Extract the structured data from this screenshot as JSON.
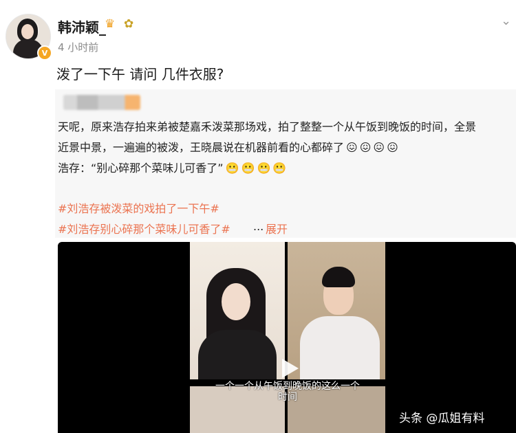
{
  "author": {
    "name": "韩沛颖_",
    "crown_icon": "crown-icon",
    "flower_icon": "flower-icon",
    "verified_badge": "V",
    "time": "4 小时前"
  },
  "post": {
    "text": "泼了一下午  请问  几件衣服?"
  },
  "quote": {
    "lines": [
      "天呢，原来浩存拍来弟被楚嘉禾泼菜那场戏，拍了整整一个从午饭到晚饭的时间，全景",
      "近景中景，一遍遍的被泼，王晓晨说在机器前看的心都碎了",
      "浩存：“别心碎那个菜味儿可香了”"
    ],
    "line2_emojis": [
      "😖",
      "😖",
      "😖",
      "😖"
    ],
    "line3_emojis": [
      "😬",
      "😬",
      "😬",
      "😬"
    ],
    "hashtags": [
      "#刘浩存被泼菜的戏拍了一下午#",
      "#刘浩存别心碎那个菜味儿可香了#"
    ],
    "more": "...",
    "expand": "展开"
  },
  "video": {
    "subtitle_line1": "一个一个从午饭到晚饭的这么一个",
    "subtitle_line2": "时间",
    "watermark": "头条 @瓜姐有料"
  },
  "colors": {
    "accent": "#eb7350",
    "verified": "#f5a623",
    "quote_bg": "#f7f7f7"
  }
}
